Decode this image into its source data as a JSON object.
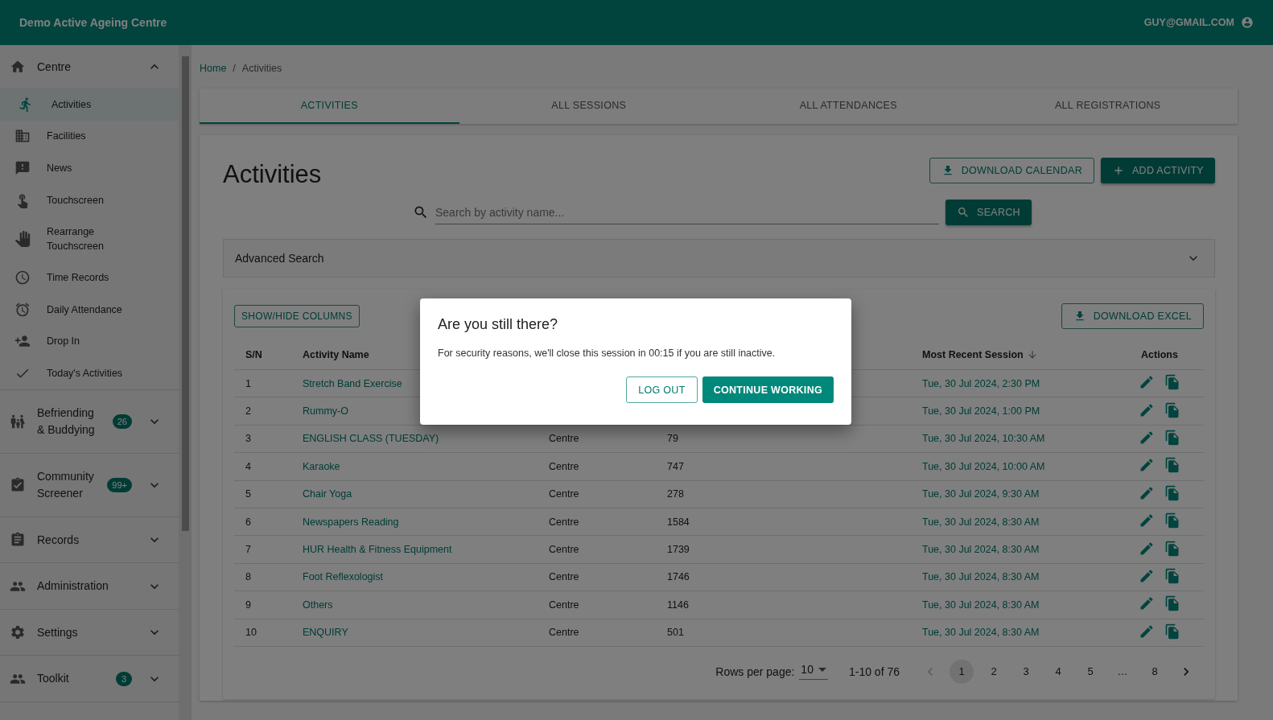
{
  "app_bar": {
    "title": "Demo Active Ageing Centre",
    "user": "GUY@GMAIL.COM"
  },
  "sidebar": {
    "sections": [
      {
        "label": "Centre",
        "expanded": true,
        "children": [
          {
            "label": "Activities",
            "selected": true
          },
          {
            "label": "Facilities",
            "selected": false
          },
          {
            "label": "News",
            "selected": false
          },
          {
            "label": "Touchscreen",
            "selected": false
          },
          {
            "label": "Rearrange Touchscreen",
            "selected": false
          },
          {
            "label": "Time Records",
            "selected": false
          },
          {
            "label": "Daily Attendance",
            "selected": false
          },
          {
            "label": "Drop In",
            "selected": false
          },
          {
            "label": "Today's Activities",
            "selected": false
          }
        ]
      },
      {
        "label": "Befriending & Buddying",
        "badge": "26",
        "expanded": false
      },
      {
        "label": "Community Screener",
        "badge": "99+",
        "expanded": false
      },
      {
        "label": "Records",
        "expanded": false
      },
      {
        "label": "Administration",
        "expanded": false
      },
      {
        "label": "Settings",
        "expanded": false
      },
      {
        "label": "Toolkit",
        "badge": "3",
        "expanded": false
      }
    ]
  },
  "breadcrumb": [
    "Home",
    "Activities"
  ],
  "breadcrumb_separator": "/",
  "tabs": [
    {
      "label": "ACTIVITIES",
      "selected": true
    },
    {
      "label": "ALL SESSIONS",
      "selected": false
    },
    {
      "label": "ALL ATTENDANCES",
      "selected": false
    },
    {
      "label": "ALL REGISTRATIONS",
      "selected": false
    }
  ],
  "page_title": "Activities",
  "buttons": {
    "download_calendar": "DOWNLOAD CALENDAR",
    "add_activity": "ADD ACTIVITY",
    "search": "SEARCH",
    "show_hide": "SHOW/HIDE COLUMNS",
    "download_excel": "DOWNLOAD EXCEL"
  },
  "search": {
    "placeholder": "Search by activity name..."
  },
  "advanced_search": {
    "label": "Advanced Search",
    "expanded": false
  },
  "table": {
    "columns": [
      "S/N",
      "Activity Name",
      "Most Recent Session",
      "Actions"
    ],
    "rows": [
      {
        "sn": "1",
        "name": "Stretch Band Exercise",
        "session": "Tue, 30 Jul 2024, 2:30 PM"
      },
      {
        "sn": "2",
        "name": "Rummy-O",
        "session": "Tue, 30 Jul 2024, 1:00 PM"
      },
      {
        "sn": "3",
        "name": "ENGLISH CLASS (TUESDAY)",
        "column_3": "Centre",
        "column_4": "79",
        "session": "Tue, 30 Jul 2024, 10:30 AM"
      },
      {
        "sn": "4",
        "name": "Karaoke",
        "column_3": "Centre",
        "column_4": "747",
        "session": "Tue, 30 Jul 2024, 10:00 AM"
      },
      {
        "sn": "5",
        "name": "Chair Yoga",
        "column_3": "Centre",
        "column_4": "278",
        "session": "Tue, 30 Jul 2024, 9:30 AM"
      },
      {
        "sn": "6",
        "name": "Newspapers Reading",
        "column_3": "Centre",
        "column_4": "1584",
        "session": "Tue, 30 Jul 2024, 8:30 AM"
      },
      {
        "sn": "7",
        "name": "HUR Health & Fitness Equipment",
        "column_3": "Centre",
        "column_4": "1739",
        "session": "Tue, 30 Jul 2024, 8:30 AM"
      },
      {
        "sn": "8",
        "name": "Foot Reflexologist",
        "column_3": "Centre",
        "column_4": "1746",
        "session": "Tue, 30 Jul 2024, 8:30 AM"
      },
      {
        "sn": "9",
        "name": "Others",
        "column_3": "Centre",
        "column_4": "1146",
        "session": "Tue, 30 Jul 2024, 8:30 AM"
      },
      {
        "sn": "10",
        "name": "ENQUIRY",
        "column_3": "Centre",
        "column_4": "501",
        "session": "Tue, 30 Jul 2024, 8:30 AM"
      }
    ]
  },
  "pagination": {
    "rows_label": "Rows per page:",
    "rows_value": "10",
    "range": "1-10 of 76",
    "prev_disabled": true,
    "next_disabled": false,
    "pages": [
      {
        "label": "1",
        "selected": true
      },
      {
        "label": "2",
        "selected": false
      },
      {
        "label": "3",
        "selected": false
      },
      {
        "label": "4",
        "selected": false
      },
      {
        "label": "5",
        "selected": false
      },
      {
        "label": "…",
        "selected": false
      },
      {
        "label": "8",
        "selected": false
      }
    ]
  },
  "dialog": {
    "title": "Are you still there?",
    "message": "For security reasons, we'll close this session in 00:15 if you are still inactive.",
    "buttons": [
      "LOG OUT",
      "CONTINUE WORKING"
    ]
  }
}
